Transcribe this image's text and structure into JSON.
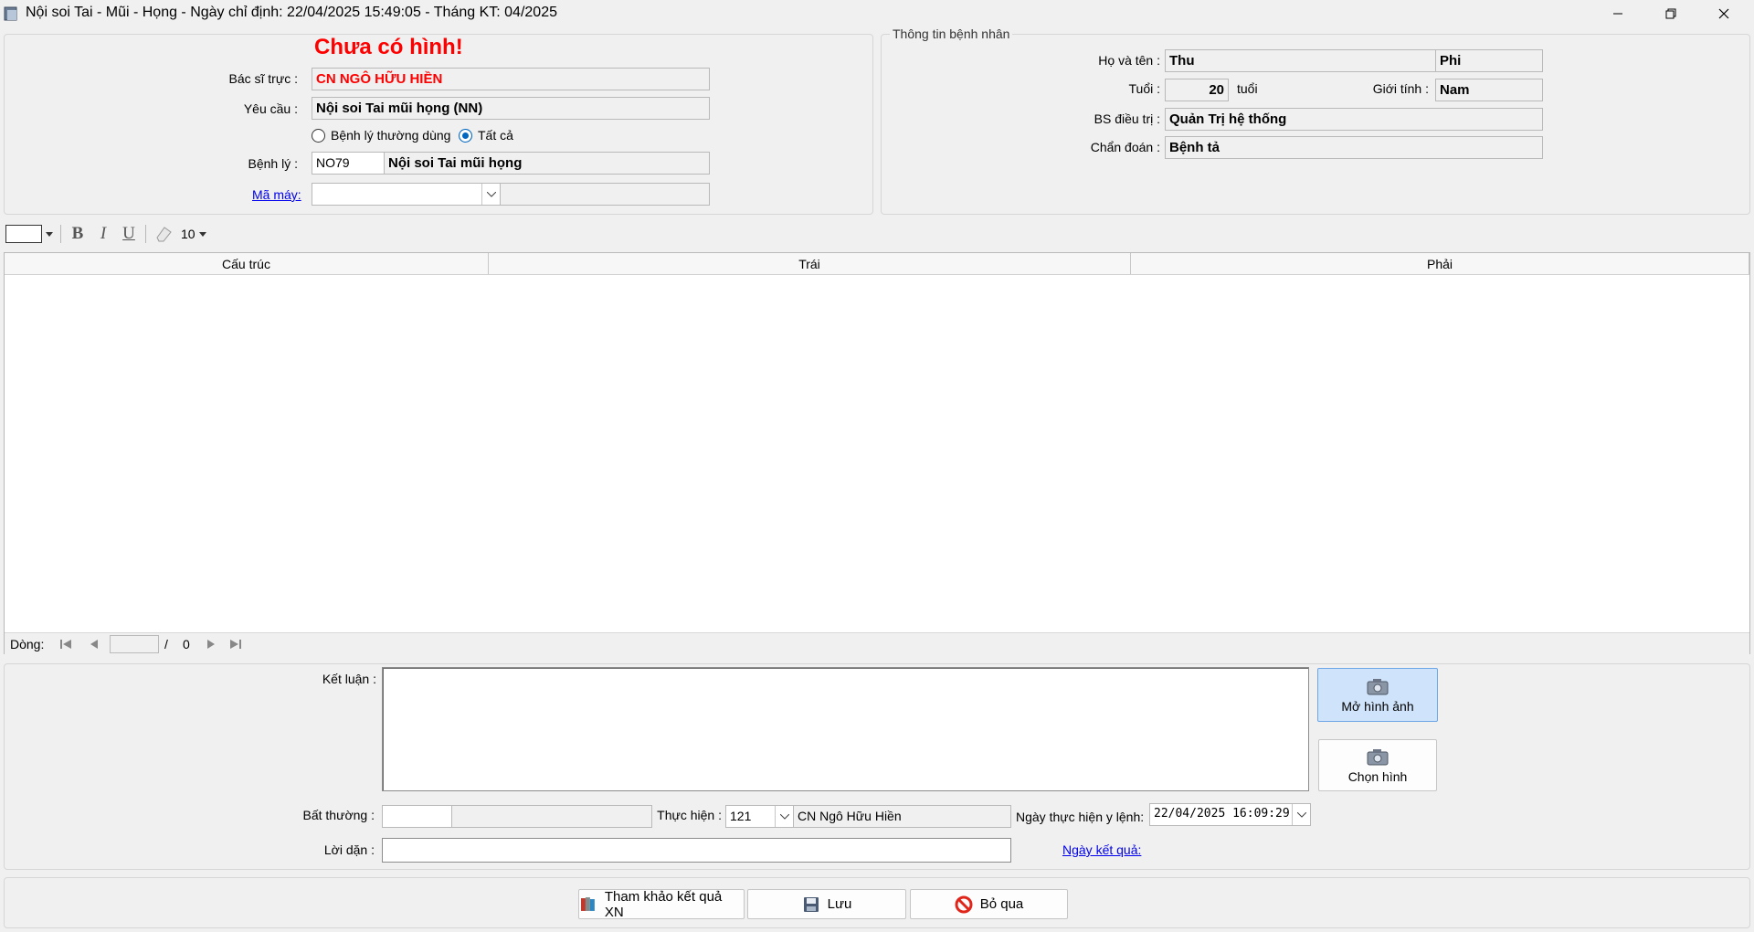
{
  "window": {
    "title": "Nội soi Tai - Mũi - Họng - Ngày chỉ định: 22/04/2025 15:49:05 - Tháng KT: 04/2025"
  },
  "header": {
    "no_image": "Chưa có hình!",
    "bac_si_truc_label": "Bác sĩ trực :",
    "bac_si_truc_value": "CN NGÔ HỮU HIỀN",
    "yeu_cau_label": "Yêu cầu :",
    "yeu_cau_value": "Nội soi Tai mũi họng (NN)",
    "radio_common": "Bệnh lý thường dùng",
    "radio_all": "Tất cả",
    "benh_ly_label": "Bệnh lý :",
    "benh_ly_code": "NO79",
    "benh_ly_name": "Nội soi Tai mũi họng",
    "ma_may_label": "Mã máy:",
    "ma_may_value": "",
    "ma_may_desc": ""
  },
  "patient": {
    "legend": "Thông tin bệnh nhân",
    "name_label": "Họ và tên :",
    "last_name": "Thu",
    "first_name": "Phi",
    "age_label": "Tuổi :",
    "age": "20",
    "age_unit": "tuổi",
    "gender_label": "Giới tính :",
    "gender": "Nam",
    "doctor_label": "BS điều trị :",
    "doctor": "Quản Trị hệ thống",
    "diagnosis_label": "Chẩn đoán :",
    "diagnosis": "Bệnh tả"
  },
  "toolbar": {
    "bold": "B",
    "italic": "I",
    "underline": "U",
    "font_size": "10"
  },
  "grid": {
    "columns": [
      "Cấu trúc",
      "Trái",
      "Phải"
    ],
    "rows": []
  },
  "nav": {
    "label": "Dòng:",
    "current": "",
    "separator": "/",
    "total": "0"
  },
  "result": {
    "ket_luan_label": "Kết luận :",
    "ket_luan_value": "",
    "open_image_btn": "Mở hình ảnh",
    "choose_image_btn": "Chọn hình",
    "bat_thuong_label": "Bất thường :",
    "bat_thuong_code": "",
    "bat_thuong_desc": "",
    "thuc_hien_label": "Thực hiện :",
    "thuc_hien_code": "121",
    "thuc_hien_name": "CN Ngô Hữu Hiền",
    "ngay_thuc_hien_label": "Ngày thực hiện y lệnh:",
    "ngay_thuc_hien_value": "22/04/2025 16:09:29",
    "loi_dan_label": "Lời dặn :",
    "loi_dan_value": "",
    "ngay_ket_qua_label": "Ngày kết quả:"
  },
  "footer": {
    "reference_btn": "Tham khảo kết quả XN",
    "save_btn": "Lưu",
    "cancel_btn": "Bỏ qua"
  },
  "colors": {
    "accent_red": "#ff0000",
    "link_blue": "#0000ee",
    "selected_button": "#cfe3fb"
  }
}
